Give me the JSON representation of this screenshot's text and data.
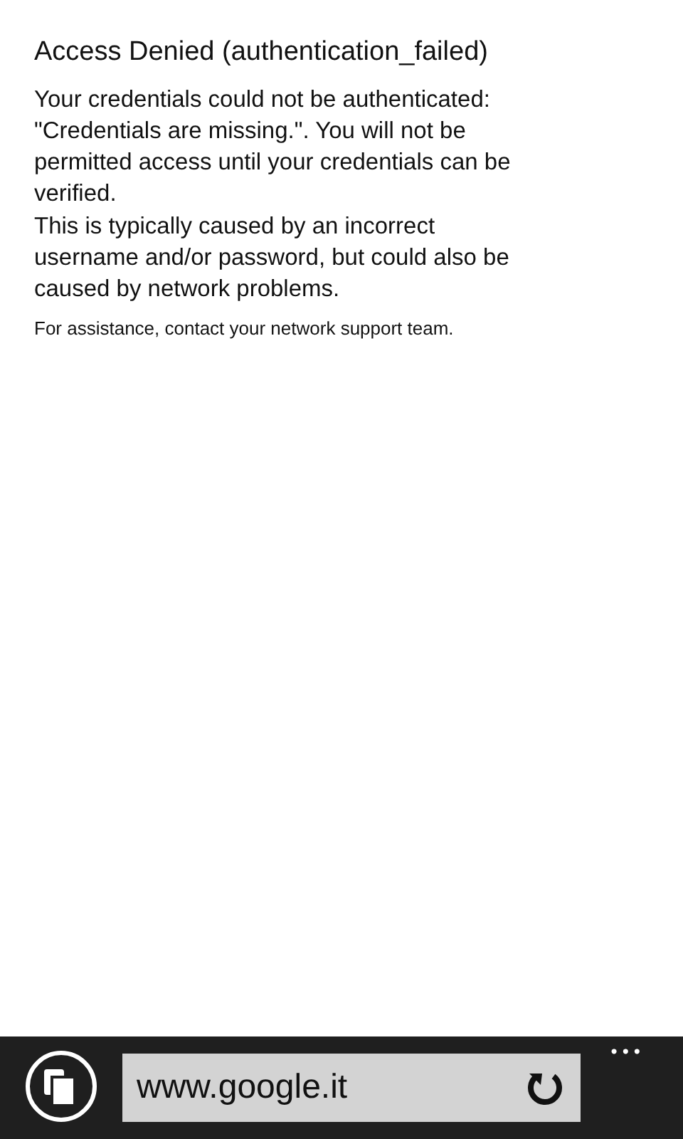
{
  "page": {
    "title": "Access Denied (authentication_failed)",
    "paragraphs": [
      "Your credentials could not be authenticated: \"Credentials are missing.\". You will not be permitted access until your credentials can be verified.",
      "This is typically caused by an incorrect username and/or password, but could also be caused by network problems."
    ],
    "note": "For assistance, contact your network support team."
  },
  "address_bar": {
    "url": "www.google.it",
    "more": "•••"
  }
}
